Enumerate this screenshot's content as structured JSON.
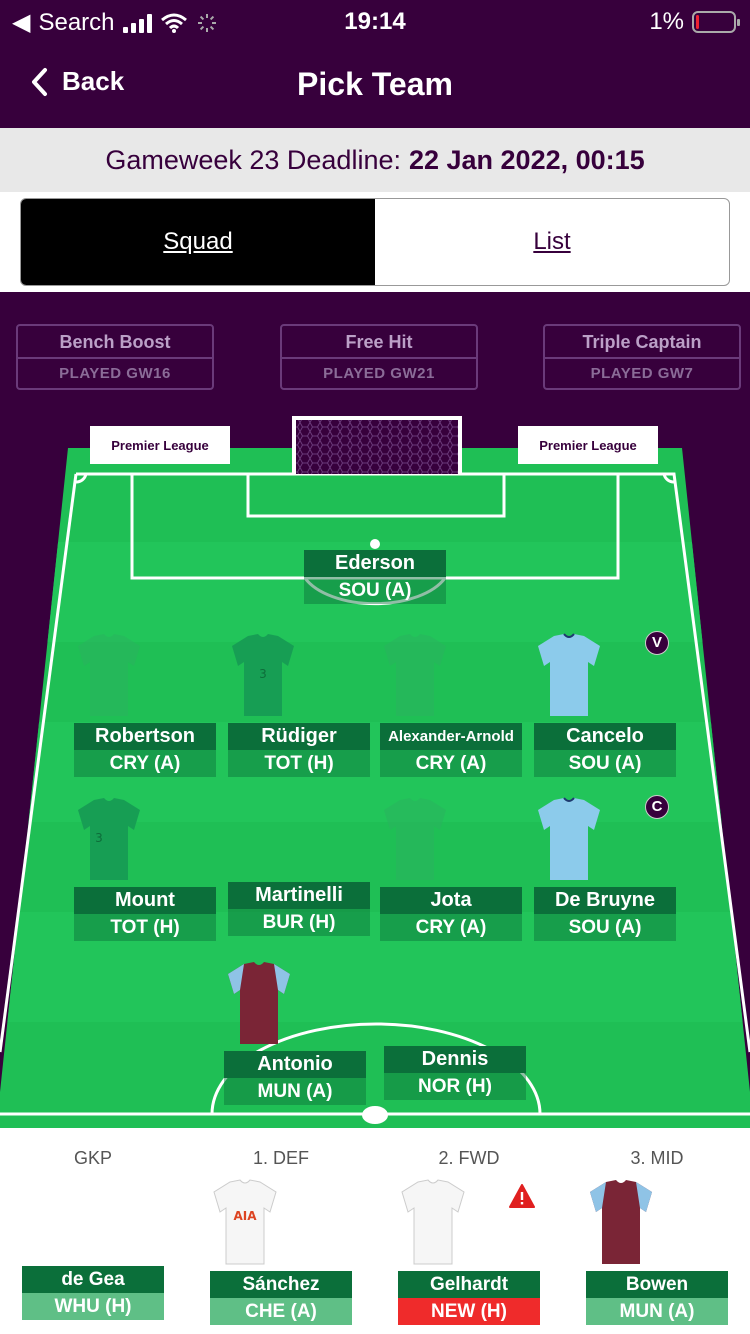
{
  "status_bar": {
    "back_app": "Search",
    "time": "19:14",
    "battery": "1%"
  },
  "nav": {
    "back_label": "Back",
    "title": "Pick Team"
  },
  "deadline": {
    "label": "Gameweek 23 Deadline:",
    "value": "22 Jan 2022, 00:15"
  },
  "tabs": {
    "squad": "Squad",
    "list": "List",
    "selected": "Squad"
  },
  "chips": [
    {
      "name": "Bench Boost",
      "status": "PLAYED GW16"
    },
    {
      "name": "Free Hit",
      "status": "PLAYED GW21"
    },
    {
      "name": "Triple Captain",
      "status": "PLAYED GW7"
    }
  ],
  "boards": {
    "left": "Premier League",
    "right": "Premier League"
  },
  "starting": {
    "gk": [
      {
        "name": "Ederson",
        "fixture": "SOU (A)"
      }
    ],
    "def": [
      {
        "name": "Robertson",
        "fixture": "CRY (A)"
      },
      {
        "name": "Rüdiger",
        "fixture": "TOT (H)"
      },
      {
        "name": "Alexander-Arnold",
        "fixture": "CRY (A)"
      },
      {
        "name": "Cancelo",
        "fixture": "SOU (A)",
        "badge": "V"
      }
    ],
    "mid": [
      {
        "name": "Mount",
        "fixture": "TOT (H)"
      },
      {
        "name": "Martinelli",
        "fixture": "BUR (H)"
      },
      {
        "name": "Jota",
        "fixture": "CRY (A)"
      },
      {
        "name": "De Bruyne",
        "fixture": "SOU (A)",
        "badge": "C"
      }
    ],
    "fwd": [
      {
        "name": "Antonio",
        "fixture": "MUN (A)"
      },
      {
        "name": "Dennis",
        "fixture": "NOR (H)"
      }
    ]
  },
  "bench": [
    {
      "pos": "GKP",
      "name": "de Gea",
      "fixture": "WHU (H)"
    },
    {
      "pos": "1. DEF",
      "name": "Sánchez",
      "fixture": "CHE (A)"
    },
    {
      "pos": "2. FWD",
      "name": "Gelhardt",
      "fixture": "NEW (H)",
      "flag": "warning"
    },
    {
      "pos": "3. MID",
      "name": "Bowen",
      "fixture": "MUN (A)"
    }
  ],
  "colors": {
    "primary": "#37003c",
    "pitch": "#1fbf55",
    "label_green": "#0b6f3a",
    "alert_red": "#ef2b2b"
  }
}
